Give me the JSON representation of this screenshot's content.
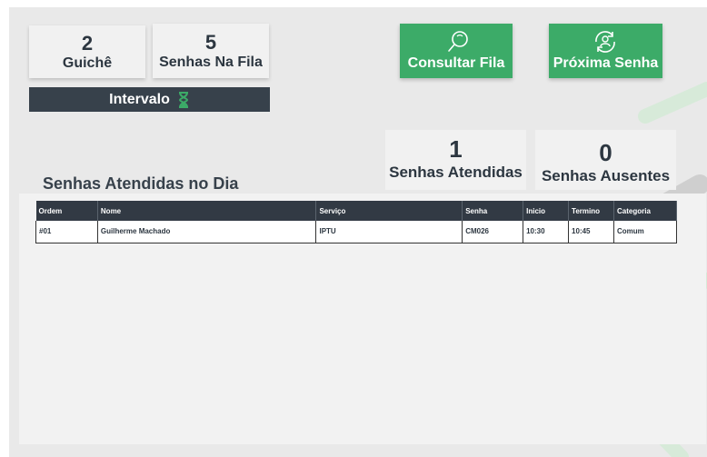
{
  "header": {
    "guiche": {
      "value": "2",
      "label": "Guichê"
    },
    "fila": {
      "value": "5",
      "label": "Senhas Na Fila"
    },
    "intervalo": {
      "label": "Intervalo"
    }
  },
  "buttons": {
    "consultar": {
      "label": "Consultar Fila",
      "icon": "search-icon"
    },
    "proxima": {
      "label": "Próxima Senha",
      "icon": "refresh-user-icon"
    }
  },
  "stats": {
    "atendidas": {
      "value": "1",
      "label": "Senhas Atendidas"
    },
    "ausentes": {
      "value": "0",
      "label": "Senhas Ausentes"
    }
  },
  "section": {
    "title": "Senhas Atendidas no Dia"
  },
  "table": {
    "columns": [
      "Ordem",
      "Nome",
      "Serviço",
      "Senha",
      "Inicio",
      "Termino",
      "Categoria"
    ],
    "rows": [
      [
        "#01",
        "Guilherme Machado",
        "IPTU",
        "CM026",
        "10:30",
        "10:45",
        "Comum"
      ]
    ]
  },
  "colors": {
    "accent": "#3cab68",
    "dark": "#37414b",
    "background": "#e9e9e9"
  }
}
